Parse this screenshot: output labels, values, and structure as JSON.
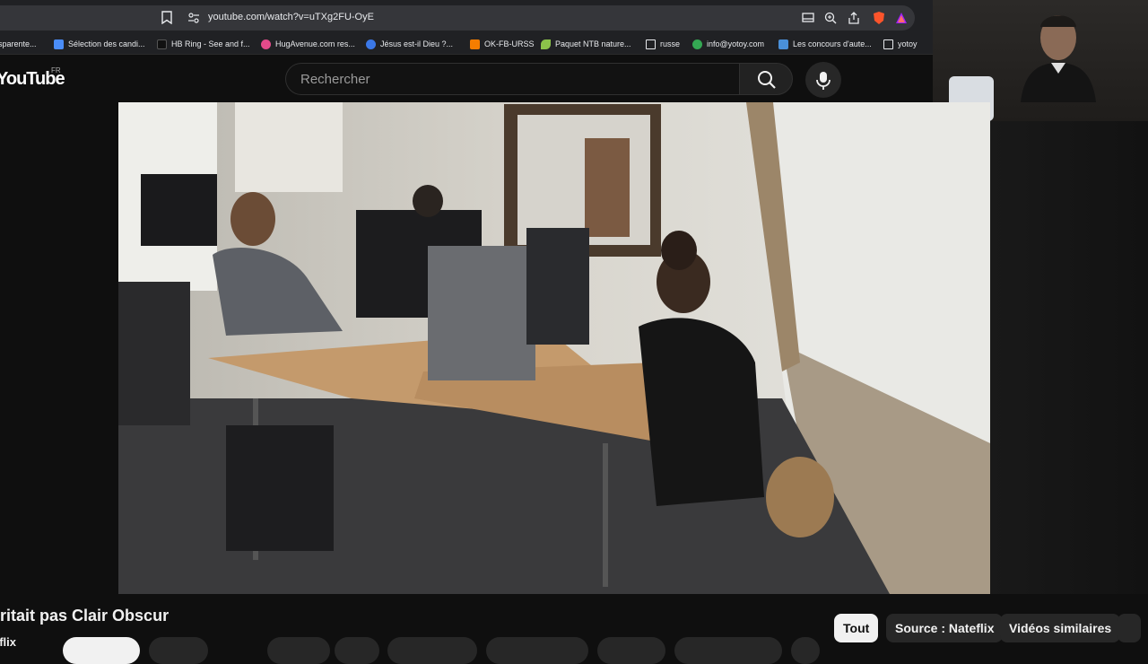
{
  "browser": {
    "url": "youtube.com/watch?v=uTXg2FU-OyE",
    "bookmarks": [
      {
        "label": "sparente...",
        "icon": "doc-icon",
        "color": "#3a3a3a"
      },
      {
        "label": "Sélection des candi...",
        "icon": "doc-icon",
        "color": "#4a8df8"
      },
      {
        "label": "HB Ring - See and f...",
        "icon": "t-icon",
        "color": "#111111"
      },
      {
        "label": "HugAvenue.com res...",
        "icon": "heart-icon",
        "color": "#e44a8a"
      },
      {
        "label": "Jésus est-il Dieu ?...",
        "icon": "globe-icon",
        "color": "#3b78e7"
      },
      {
        "label": "OK-FB-URSS",
        "icon": "blogger-icon",
        "color": "#f57d00"
      },
      {
        "label": "Paquet NTB nature...",
        "icon": "leaf-icon",
        "color": "#8bc34a"
      },
      {
        "label": "russe",
        "icon": "folder-icon",
        "color": "#e8eaed"
      },
      {
        "label": "info@yotoy.com",
        "icon": "globe-icon",
        "color": "#34a853"
      },
      {
        "label": "Les concours d'aute...",
        "icon": "image-icon",
        "color": "#4a90d9"
      },
      {
        "label": "yotoy",
        "icon": "folder-icon",
        "color": "#e8eaed"
      }
    ]
  },
  "header": {
    "logo": "YouTube",
    "country": "FR",
    "search_placeholder": "Rechercher"
  },
  "video": {
    "title": "éritait pas Clair Obscur",
    "channel": "eflix"
  },
  "chips": {
    "all": "Tout",
    "source": "Source : Nateflix",
    "similar": "Vidéos similaires"
  },
  "colors": {
    "background": "#0f0f0f",
    "chip_active": "#f1f1f1",
    "chip_normal": "#272727"
  }
}
